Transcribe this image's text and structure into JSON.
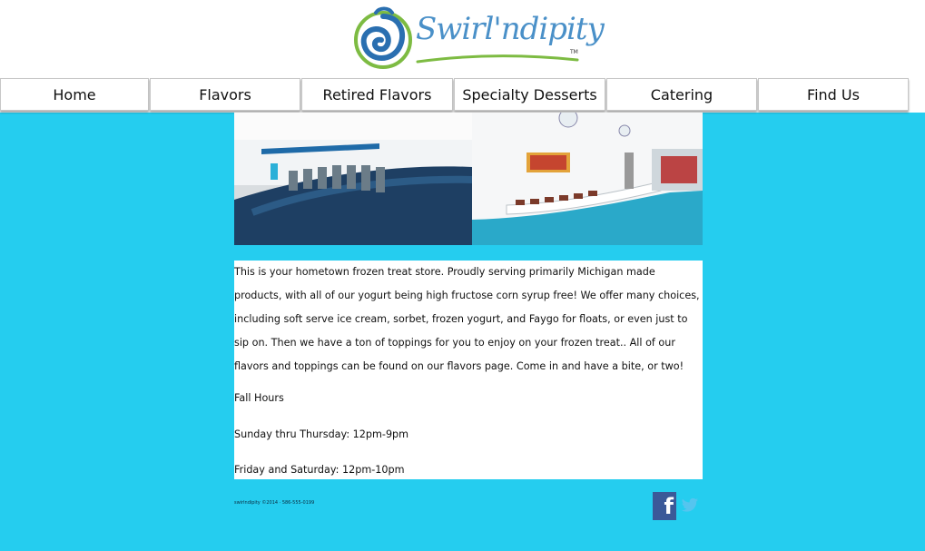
{
  "header": {
    "logo_text": "Swirl'ndipity",
    "logo_tm": "TM"
  },
  "nav": {
    "items": [
      {
        "label": "Home"
      },
      {
        "label": "Flavors"
      },
      {
        "label": "Retired Flavors"
      },
      {
        "label": "Specialty Desserts"
      },
      {
        "label": "Catering"
      },
      {
        "label": "Find Us"
      }
    ]
  },
  "content": {
    "intro": "This is your hometown frozen treat store. Proudly serving primarily Michigan made products, with all of our yogurt being high fructose corn syrup free! We offer many choices, including soft serve ice cream, sorbet, frozen yogurt, and Faygo for floats, or even just to sip on. Then we have a ton of toppings for you to enjoy on your frozen treat.. All of our flavors and toppings can be found on our flavors page. Come in and have a bite, or two!",
    "hours_title": "Fall Hours",
    "hours_weekday": "Sunday thru Thursday: 12pm-9pm",
    "hours_weekend": "Friday and Saturday: 12pm-10pm"
  },
  "footer": {
    "copyright": "swirlndipity ©2014 · 586-555-0199"
  },
  "social": {
    "facebook_icon": "facebook-icon",
    "twitter_icon": "twitter-icon"
  },
  "colors": {
    "background": "#25cdef",
    "facebook": "#3b5998",
    "twitter": "#55c5ef",
    "logo_blue": "#4a90c8",
    "logo_green": "#7dbb42"
  }
}
